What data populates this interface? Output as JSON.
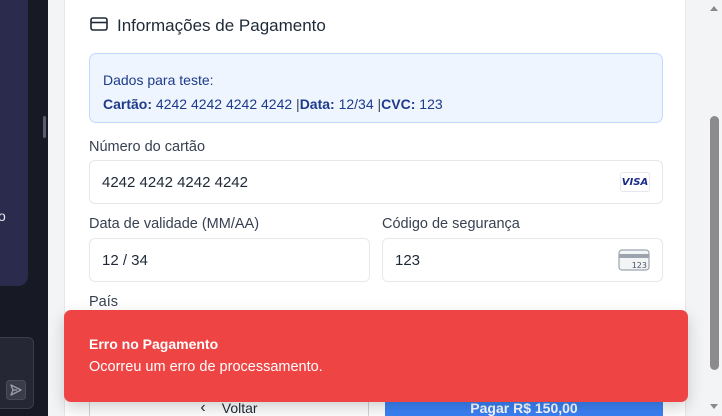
{
  "colors": {
    "accent_blue": "#3b82f6",
    "toast_red": "#ef4444",
    "info_bg": "#eef5ff",
    "info_text": "#1e3a8a"
  },
  "sidebar": {
    "partial_char": "o"
  },
  "payment": {
    "section_title": "Informações de Pagamento",
    "section_icon": "credit-card-icon",
    "test_data": {
      "heading": "Dados para teste:",
      "card_label": "Cartão:",
      "card_value": "4242 4242 4242 4242",
      "date_label": "Data:",
      "date_value": "12/34",
      "cvc_label": "CVC:",
      "cvc_value": "123",
      "separator": "|"
    },
    "card_number": {
      "label": "Número do cartão",
      "value": "4242 4242 4242 4242",
      "brand": "VISA"
    },
    "expiry": {
      "label": "Data de validade (MM/AA)",
      "value": "12 / 34"
    },
    "cvc": {
      "label": "Código de segurança",
      "value": "123",
      "icon_text": "123"
    },
    "country": {
      "label": "País"
    },
    "back_button": {
      "label": "Voltar"
    },
    "pay_button": {
      "label": "Pagar R$ 150,00"
    }
  },
  "toast": {
    "title": "Erro no Pagamento",
    "description": "Ocorreu um erro de processamento."
  }
}
